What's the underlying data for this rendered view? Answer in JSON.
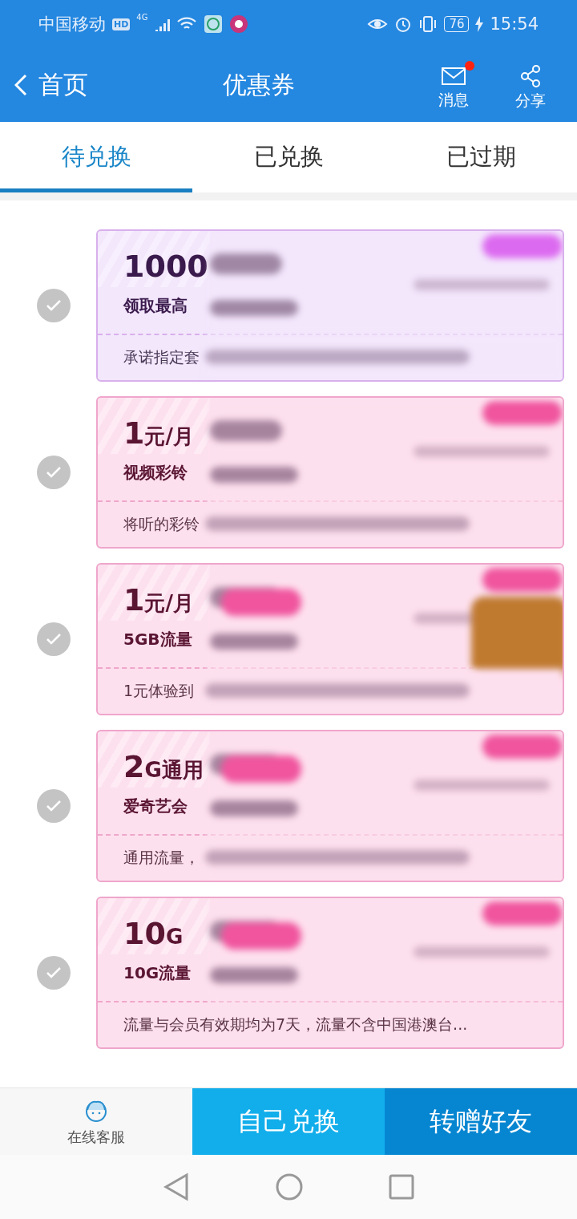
{
  "status_bar": {
    "carrier": "中国移动",
    "hd": "HD",
    "network": "4G",
    "battery": "76",
    "time": "15:54"
  },
  "header": {
    "back": "首页",
    "title": "优惠券",
    "actions": [
      {
        "kind": "message",
        "label": "消息",
        "unread": true
      },
      {
        "kind": "share",
        "label": "分享",
        "unread": false
      }
    ]
  },
  "tabs": [
    {
      "label": "待兑换",
      "selected": true
    },
    {
      "label": "已兑换",
      "selected": false
    },
    {
      "label": "已过期",
      "selected": false
    }
  ],
  "coupons": [
    {
      "kind": "points",
      "checked": false,
      "value": "1000",
      "title": "领取最高",
      "desc": "承诺指定套",
      "desc_blurred": true,
      "pill": false,
      "image": false
    },
    {
      "kind": "package",
      "checked": false,
      "value": "1",
      "unit": "元/月",
      "title": "视频彩铃",
      "desc": "将听的彩铃",
      "desc_blurred": true,
      "pill": false,
      "image": false
    },
    {
      "kind": "package",
      "checked": false,
      "value": "1",
      "unit": "元/月",
      "title": "5GB流量",
      "desc": "1元体验到",
      "desc_blurred": true,
      "pill": true,
      "image": true
    },
    {
      "kind": "package",
      "checked": false,
      "value": "2",
      "unit": "G通用",
      "title": "爱奇艺会",
      "desc": "通用流量，",
      "desc_blurred": true,
      "pill": true,
      "image": false
    },
    {
      "kind": "package",
      "checked": false,
      "value": "10",
      "unit": "G",
      "title": "10G流量",
      "desc": "流量与会员有效期均为7天，流量不含中国港澳台...",
      "desc_blurred": false,
      "pill": true,
      "image": false
    }
  ],
  "footer": {
    "service": "在线客服",
    "buttons": [
      {
        "kind": "primary",
        "label": "自己兑换"
      },
      {
        "kind": "secondary",
        "label": "转赠好友"
      }
    ]
  }
}
